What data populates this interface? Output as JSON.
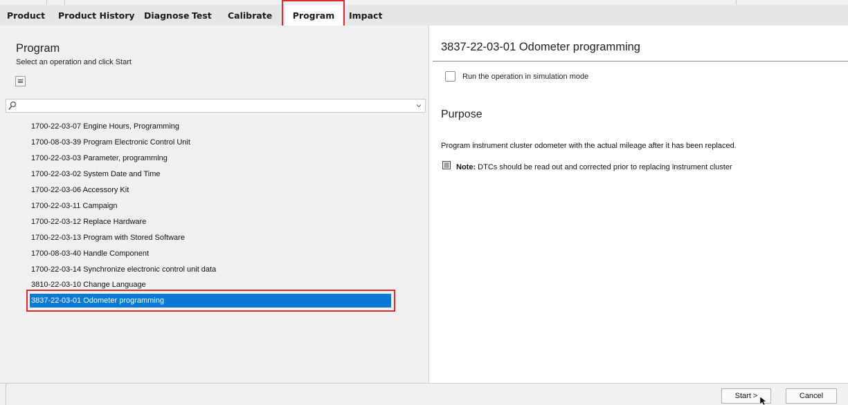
{
  "tabs": [
    {
      "label": "Product"
    },
    {
      "label": "Product History"
    },
    {
      "label": "Diagnose"
    },
    {
      "label": "Test"
    },
    {
      "label": "Calibrate"
    },
    {
      "label": "Program",
      "active": true
    },
    {
      "label": "Impact"
    }
  ],
  "left": {
    "title": "Program",
    "subtitle": "Select an operation and click Start",
    "search_value": "",
    "operations": [
      "1700-22-03-07  Engine Hours, Programming",
      "1700-08-03-39 Program Electronic Control Unit",
      "1700-22-03-03 Parameter, programming",
      "1700-22-03-02 System Date and Time",
      "1700-22-03-06 Accessory Kit",
      "1700-22-03-11 Campaign",
      "1700-22-03-12 Replace Hardware",
      "1700-22-03-13 Program with Stored Software",
      "1700-08-03-40 Handle Component",
      "1700-22-03-14 Synchronize electronic control unit data",
      "3810-22-03-10 Change Language",
      "3837-22-03-01 Odometer programming"
    ],
    "selected_index": 11
  },
  "right": {
    "title": "3837-22-03-01 Odometer programming",
    "simulation_label": "Run the operation in simulation mode",
    "simulation_checked": false,
    "purpose_heading": "Purpose",
    "purpose_text": "Program instrument cluster odometer with the actual mileage after it has been replaced.",
    "note_label": "Note:",
    "note_text": " DTCs should be read out and corrected prior to replacing instrument cluster"
  },
  "buttons": {
    "start": "Start >",
    "cancel": "Cancel"
  },
  "colors": {
    "selection": "#0a79d6",
    "highlight_box": "#e0282e",
    "tabbar_bg": "#e6e6e6",
    "panel_bg": "#f0f0f0"
  },
  "icons": [
    "search-icon",
    "chevron-down-icon",
    "collapse-all-icon",
    "note-icon",
    "mouse-cursor-icon"
  ]
}
